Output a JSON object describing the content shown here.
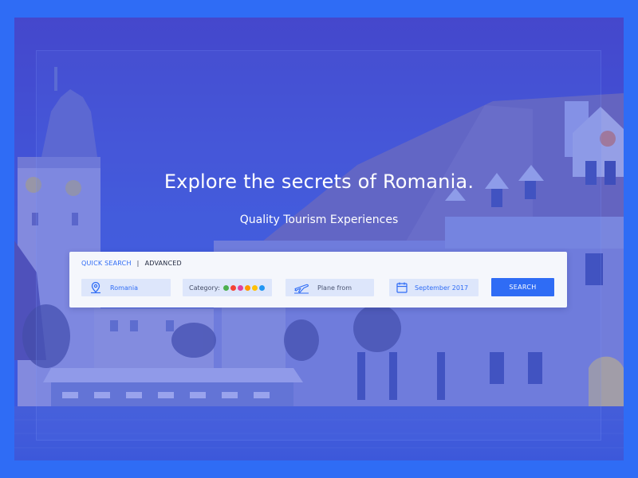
{
  "hero": {
    "title": "Explore the secrets of Romania.",
    "subtitle": "Quality Tourism Experiences"
  },
  "search_panel": {
    "tabs": [
      {
        "label": "QUICK SEARCH",
        "active": true
      },
      {
        "label": "ADVANCED",
        "active": false
      }
    ],
    "separator": "|",
    "location": {
      "value": "Romania",
      "icon": "map-pin-icon"
    },
    "category": {
      "label": "Category:",
      "dot_colors": [
        "#4caf50",
        "#f44336",
        "#e040a0",
        "#ff9800",
        "#ffc107",
        "#2196f3"
      ]
    },
    "plane": {
      "placeholder": "Plane from",
      "icon": "airplane-icon"
    },
    "date": {
      "value": "September 2017",
      "icon": "calendar-icon"
    },
    "search_button_label": "SEARCH"
  },
  "colors": {
    "accent": "#2f6cf5",
    "field_bg": "#dde6fb",
    "panel_bg": "#f5f7fc"
  }
}
